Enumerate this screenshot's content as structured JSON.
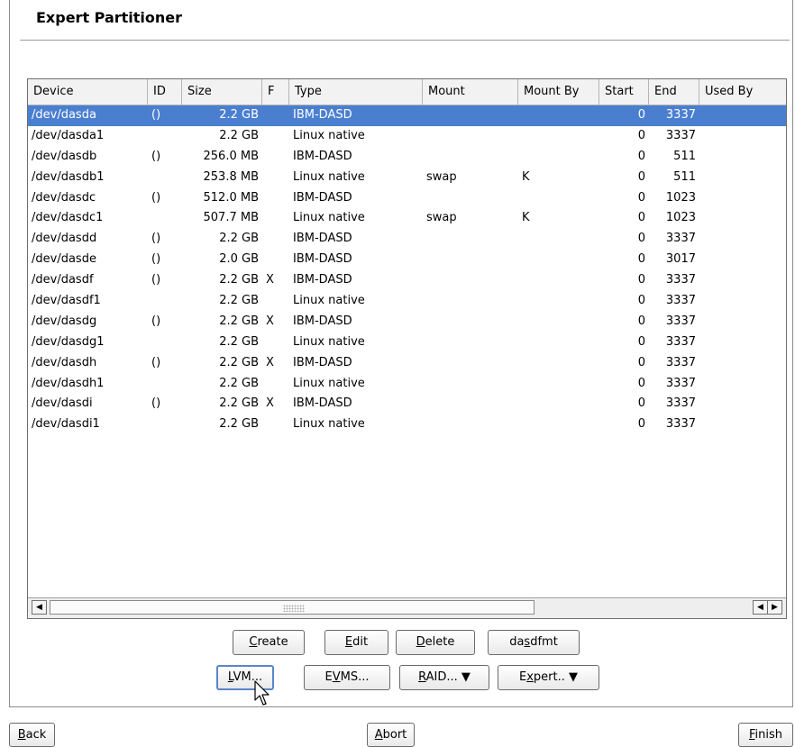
{
  "window": {
    "title": "Expert Partitioner"
  },
  "table": {
    "columns": [
      "Device",
      "ID",
      "Size",
      "F",
      "Type",
      "Mount",
      "Mount By",
      "Start",
      "End",
      "Used By"
    ],
    "rows": [
      {
        "device": "/dev/dasda",
        "id": "()",
        "size": "2.2 GB",
        "f": "",
        "type": "IBM-DASD",
        "mount": "",
        "mount_by": "",
        "start": "0",
        "end": "3337",
        "used_by": "",
        "selected": true
      },
      {
        "device": "/dev/dasda1",
        "id": "",
        "size": "2.2 GB",
        "f": "",
        "type": "Linux native",
        "mount": "",
        "mount_by": "",
        "start": "0",
        "end": "3337",
        "used_by": ""
      },
      {
        "device": "/dev/dasdb",
        "id": "()",
        "size": "256.0 MB",
        "f": "",
        "type": "IBM-DASD",
        "mount": "",
        "mount_by": "",
        "start": "0",
        "end": "511",
        "used_by": ""
      },
      {
        "device": "/dev/dasdb1",
        "id": "",
        "size": "253.8 MB",
        "f": "",
        "type": "Linux native",
        "mount": "swap",
        "mount_by": "K",
        "start": "0",
        "end": "511",
        "used_by": ""
      },
      {
        "device": "/dev/dasdc",
        "id": "()",
        "size": "512.0 MB",
        "f": "",
        "type": "IBM-DASD",
        "mount": "",
        "mount_by": "",
        "start": "0",
        "end": "1023",
        "used_by": ""
      },
      {
        "device": "/dev/dasdc1",
        "id": "",
        "size": "507.7 MB",
        "f": "",
        "type": "Linux native",
        "mount": "swap",
        "mount_by": "K",
        "start": "0",
        "end": "1023",
        "used_by": ""
      },
      {
        "device": "/dev/dasdd",
        "id": "()",
        "size": "2.2 GB",
        "f": "",
        "type": "IBM-DASD",
        "mount": "",
        "mount_by": "",
        "start": "0",
        "end": "3337",
        "used_by": ""
      },
      {
        "device": "/dev/dasde",
        "id": "()",
        "size": "2.0 GB",
        "f": "",
        "type": "IBM-DASD",
        "mount": "",
        "mount_by": "",
        "start": "0",
        "end": "3017",
        "used_by": ""
      },
      {
        "device": "/dev/dasdf",
        "id": "()",
        "size": "2.2 GB",
        "f": "X",
        "type": "IBM-DASD",
        "mount": "",
        "mount_by": "",
        "start": "0",
        "end": "3337",
        "used_by": ""
      },
      {
        "device": "/dev/dasdf1",
        "id": "",
        "size": "2.2 GB",
        "f": "",
        "type": "Linux native",
        "mount": "",
        "mount_by": "",
        "start": "0",
        "end": "3337",
        "used_by": ""
      },
      {
        "device": "/dev/dasdg",
        "id": "()",
        "size": "2.2 GB",
        "f": "X",
        "type": "IBM-DASD",
        "mount": "",
        "mount_by": "",
        "start": "0",
        "end": "3337",
        "used_by": ""
      },
      {
        "device": "/dev/dasdg1",
        "id": "",
        "size": "2.2 GB",
        "f": "",
        "type": "Linux native",
        "mount": "",
        "mount_by": "",
        "start": "0",
        "end": "3337",
        "used_by": ""
      },
      {
        "device": "/dev/dasdh",
        "id": "()",
        "size": "2.2 GB",
        "f": "X",
        "type": "IBM-DASD",
        "mount": "",
        "mount_by": "",
        "start": "0",
        "end": "3337",
        "used_by": ""
      },
      {
        "device": "/dev/dasdh1",
        "id": "",
        "size": "2.2 GB",
        "f": "",
        "type": "Linux native",
        "mount": "",
        "mount_by": "",
        "start": "0",
        "end": "3337",
        "used_by": ""
      },
      {
        "device": "/dev/dasdi",
        "id": "()",
        "size": "2.2 GB",
        "f": "X",
        "type": "IBM-DASD",
        "mount": "",
        "mount_by": "",
        "start": "0",
        "end": "3337",
        "used_by": ""
      },
      {
        "device": "/dev/dasdi1",
        "id": "",
        "size": "2.2 GB",
        "f": "",
        "type": "Linux native",
        "mount": "",
        "mount_by": "",
        "start": "0",
        "end": "3337",
        "used_by": ""
      }
    ]
  },
  "scrollbar": {
    "left_icon": "scroll-left-arrow-icon",
    "right_icon": "scroll-right-arrow-icon"
  },
  "buttons": {
    "create": {
      "pre": "",
      "key": "C",
      "post": "reate"
    },
    "edit": {
      "pre": "",
      "key": "E",
      "post": "dit"
    },
    "delete": {
      "pre": "",
      "key": "D",
      "post": "elete"
    },
    "dasdfmt": {
      "pre": "da",
      "key": "s",
      "post": "dfmt"
    },
    "lvm": {
      "pre": "",
      "key": "L",
      "post": "VM..."
    },
    "evms": {
      "pre": "E",
      "key": "V",
      "post": "MS..."
    },
    "raid": {
      "pre": "",
      "key": "R",
      "post": "AID...",
      "arrow": "▼"
    },
    "expert": {
      "pre": "E",
      "key": "x",
      "post": "pert..",
      "arrow": "▼"
    },
    "back": {
      "pre": "",
      "key": "B",
      "post": "ack"
    },
    "abort": {
      "pre": "",
      "key": "A",
      "post": "bort"
    },
    "finish": {
      "pre": "",
      "key": "F",
      "post": "inish"
    }
  },
  "colors": {
    "selection": "#4a7fd0",
    "focus_border": "#5a86c8"
  }
}
